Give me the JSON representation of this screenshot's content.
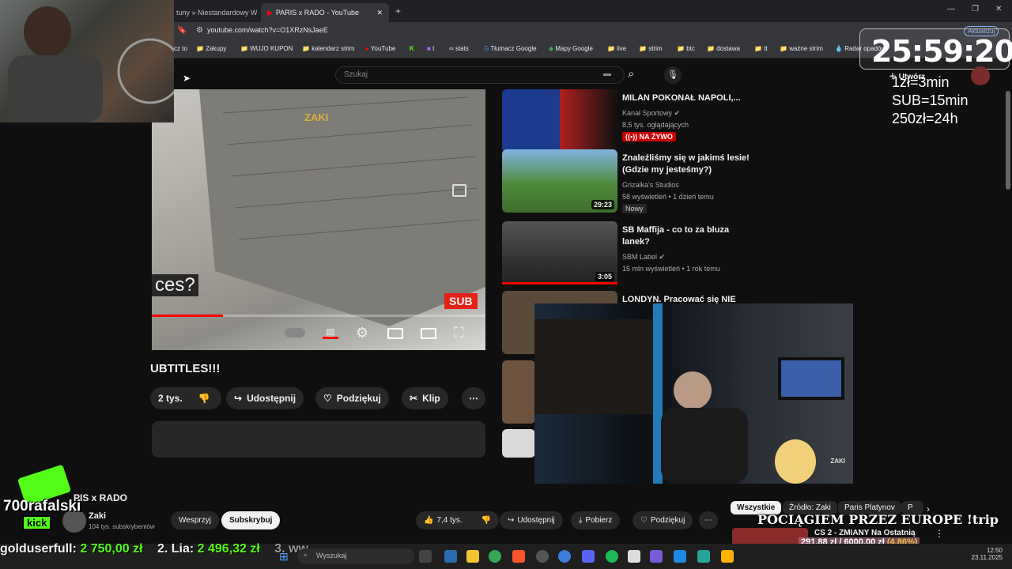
{
  "browser": {
    "tabs": [
      "tuny » Niestandardowy Wyb",
      "PARIS x RADO - YouTube"
    ],
    "url": "youtube.com/watch?v=O1XRzNsJaeE",
    "bookmarks": [
      "cz to",
      "Zakupy",
      "WUJO KUPON",
      "kalendarz strim",
      "YouTube",
      "t",
      "stats",
      "Tłumacz Google",
      "Mapy Google",
      "live",
      "strim",
      "btc",
      "dostawa",
      "tt",
      "ważne strim",
      "Radar opadów"
    ],
    "update_label": "Aktualizuj"
  },
  "youtube": {
    "search_placeholder": "Szukaj",
    "create_label": "Utwórz",
    "video_caption": "ces?",
    "video_watermark": "ZAKI",
    "sub_badge": "SUB",
    "video_title_partial": "UBTITLES!!!",
    "like_count_partial": "2 tys.",
    "actions": [
      "Udostępnij",
      "Podziękuj",
      "Klip"
    ],
    "sidebar": [
      {
        "title": "MILAN POKONAŁ NAPOLI,...",
        "channel": "Kanał Sportowy",
        "meta": "8,5 tys. oglądających",
        "badge": "NA ŻYWO",
        "duration": ""
      },
      {
        "title": "Znaleźliśmy się w jakimś lesie! (Gdzie my jesteśmy?)",
        "channel": "Grizalka's Studios",
        "meta": "58 wyświetleń  •  1 dzień temu",
        "badge": "Nowy",
        "duration": "29:23"
      },
      {
        "title": "SB Maffija - co to za bluza lanek?",
        "channel": "SBM Label",
        "meta": "15 mln wyświetleń  •  1 rok temu",
        "badge": "",
        "duration": "3:05"
      },
      {
        "title": "LONDYN. Pracować się NIE",
        "channel": "",
        "meta": "",
        "badge": "",
        "duration": ""
      }
    ]
  },
  "stream": {
    "timer": "25:59:20",
    "rules": [
      "1zł=3min",
      "SUB=15min",
      "250zł=24h"
    ],
    "kick_user": "700rafalski",
    "kick_label": "kick",
    "cam_logo": "ZAKI",
    "donors": [
      {
        "name": "golduserfull:",
        "amount": "2 750,00 zł"
      },
      {
        "name": "2. Lia:",
        "amount": "2 496,32 zł"
      },
      {
        "name": "3. ww",
        "amount": ""
      }
    ],
    "train_text": "POCIĄGIEM PRZEZ EUROPE !trip",
    "ticker_value": "291,88 zł",
    "ticker_goal": "6000,00 zł",
    "ticker_pct": "(4.86%)"
  },
  "bottom": {
    "video_title": "PIS x RADO",
    "channel": "Zaki",
    "subs": "104 tys. subskrybentów",
    "support": "Wesprzyj",
    "subscribe": "Subskrybuj",
    "likes": "7,4 tys.",
    "share": "Udostępnij",
    "download": "Pobierz",
    "thanks": "Podziękuj",
    "chips": [
      "Wszystkie",
      "Źródło: Zaki",
      "Paris Platynov",
      "P"
    ],
    "next_title": "CS 2 - ZMIANY Na Ostatnią"
  },
  "taskbar": {
    "search": "Wyszukaj",
    "time": "12:50",
    "date": "23.11.2025"
  },
  "colors": {
    "accent_red": "#ff0000",
    "kick_green": "#53fc18",
    "donor_green": "#53fc18"
  }
}
